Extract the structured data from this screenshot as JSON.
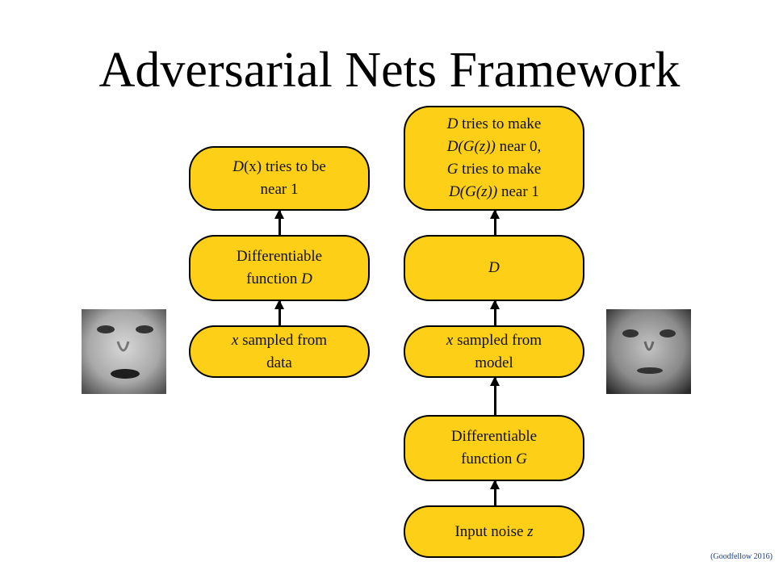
{
  "title": "Adversarial Nets Framework",
  "left": {
    "top": {
      "a": "D",
      "b": "(x) tries to be",
      "c": "near 1"
    },
    "mid": {
      "a": "Differentiable",
      "b": "function ",
      "c": "D"
    },
    "bottom": {
      "a": "x",
      "b": " sampled from",
      "c": "data"
    }
  },
  "right": {
    "top": {
      "l1a": "D",
      "l1b": " tries to make",
      "l2a": "D(G(z))",
      "l2b": " near 0,",
      "l3a": "G",
      "l3b": " tries to make",
      "l4a": "D(G(z))",
      "l4b": " near 1"
    },
    "d": {
      "a": "D"
    },
    "sample": {
      "a": "x",
      "b": " sampled from",
      "c": "model"
    },
    "gen": {
      "a": "Differentiable",
      "b": "function ",
      "c": "G"
    },
    "noise": {
      "a": "Input noise ",
      "b": "z"
    }
  },
  "colors": {
    "box": "#fdd017",
    "citation": "#1a3e8c"
  },
  "citation": "(Goodfellow 2016)"
}
